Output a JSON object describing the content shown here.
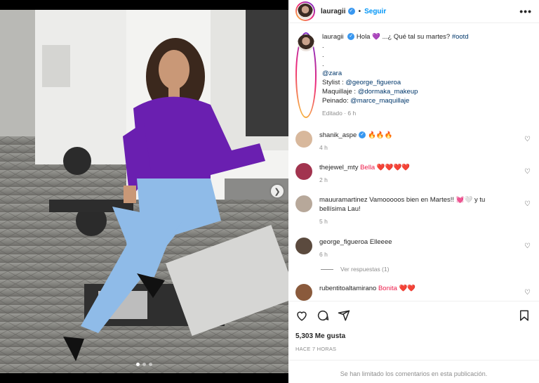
{
  "post": {
    "username": "lauragii",
    "follow_label": "Seguir",
    "separator": "•",
    "more_label": "•••"
  },
  "caption": {
    "username": "lauragii",
    "text": "Hola 💜 ...¿ Qué tal su martes? ",
    "hashtag": "#ootd",
    "dots": [
      ".",
      ".",
      "."
    ],
    "brand": "@zara",
    "stylist_label": "Stylist : ",
    "stylist": "@george_figueroa",
    "makeup_label": "Maquillaje : ",
    "makeup": "@dormaka_makeup",
    "hair_label": "Peinado: ",
    "hair": "@marce_maquillaje",
    "meta": "Editado · 6 h"
  },
  "comments": [
    {
      "username": "shanik_aspe",
      "text": " 🔥🔥🔥",
      "time": "4 h",
      "avatar_color": "#d8b89c"
    },
    {
      "username": "thejewel_mty",
      "text": " Bella ❤️❤️❤️❤️",
      "time": "2 h",
      "avatar_color": "#a2344f"
    },
    {
      "username": "mauuramartinez",
      "text": " Vamooooos bien en Martes!! 💓🤍 y tu bellísima Lau!",
      "time": "5 h",
      "avatar_color": "#b7a89a"
    },
    {
      "username": "george_figueroa",
      "text": " Elleeee",
      "time": "6 h",
      "avatar_color": "#5b4a3e"
    },
    {
      "username": "rubentitoaltamirano",
      "text": " Bonita ❤️❤️",
      "time": "",
      "avatar_color": "#8a5a3c"
    }
  ],
  "replies_label": "Ver respuestas (1)",
  "likes": "5,303 Me gusta",
  "posted_ago": "HACE 7 HORAS",
  "comments_limited": "Se han limitado los comentarios en esta publicación.",
  "carousel": {
    "slide_count": 3,
    "active_slide": 1
  },
  "colors": {
    "accent": "#0095f6",
    "verified": "#3897f0",
    "blouse": "#6a1fb0",
    "pants": "#8fbbe8"
  },
  "icons": [
    "heart-icon",
    "comment-icon",
    "share-icon",
    "bookmark-icon",
    "chevron-right-icon",
    "more-icon",
    "verified-icon"
  ]
}
